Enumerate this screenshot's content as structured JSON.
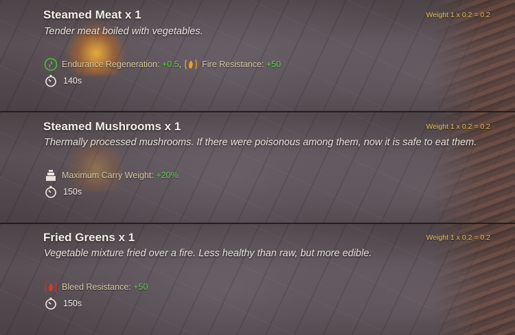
{
  "colors": {
    "weight_text": "#e7c24a",
    "effect_label": "#d7c9a4",
    "effect_value": "#5fd04a",
    "title": "#f3efe9"
  },
  "items": [
    {
      "title": "Steamed Meat x 1",
      "weight": "Weight 1 x 0.2 = 0.2",
      "description": "Tender meat boiled with vegetables.",
      "effects": [
        {
          "icon": "endurance-regeneration-icon",
          "label": "Endurance Regeneration:",
          "value": "+0.5"
        },
        {
          "icon": "fire-resistance-icon",
          "label": "Fire Resistance:",
          "value": "+50"
        }
      ],
      "duration": "140s"
    },
    {
      "title": "Steamed Mushrooms x 1",
      "weight": "Weight 1 x 0.2 = 0.2",
      "description": "Thermally processed mushrooms. If there were poisonous among them, now it is safe to eat them.",
      "effects": [
        {
          "icon": "carry-weight-icon",
          "label": "Maximum Carry Weight:",
          "value": "+20%"
        }
      ],
      "duration": "150s"
    },
    {
      "title": "Fried Greens x 1",
      "weight": "Weight 1 x 0.2 = 0.2",
      "description": "Vegetable mixture fried over a fire. Less healthy than raw, but more edible.",
      "effects": [
        {
          "icon": "bleed-resistance-icon",
          "label": "Bleed Resistance:",
          "value": "+50"
        }
      ],
      "duration": "150s"
    }
  ]
}
